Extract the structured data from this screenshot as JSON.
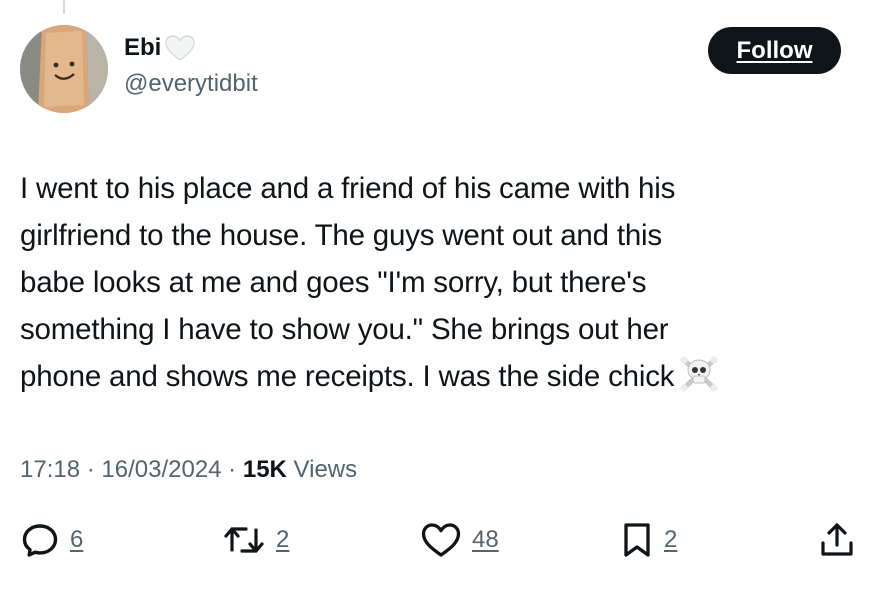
{
  "tweet": {
    "author": {
      "display_name": "Ebi",
      "handle": "@everytidbit",
      "badge_icon": "white-heart-icon"
    },
    "follow_label": "Follow",
    "text_lines": [
      "I went to his place and a friend of his came with his",
      "girlfriend to the house. The guys went out and this",
      "babe looks at me and goes \"I'm sorry, but there's",
      "something I have to show you.\" She brings out her",
      "phone and shows me receipts. I was the side chick"
    ],
    "trailing_emoji": "skull-crossbones-icon",
    "meta": {
      "time": "17:18",
      "separator": " · ",
      "date": "16/03/2024",
      "views_count": "15K",
      "views_label": "Views"
    },
    "actions": {
      "replies": "6",
      "reposts": "2",
      "likes": "48",
      "bookmarks": "2"
    }
  },
  "colors": {
    "text": "#0f1419",
    "secondary": "#536471",
    "follow_bg": "#0f1419",
    "thread_line": "#cfd9de"
  }
}
